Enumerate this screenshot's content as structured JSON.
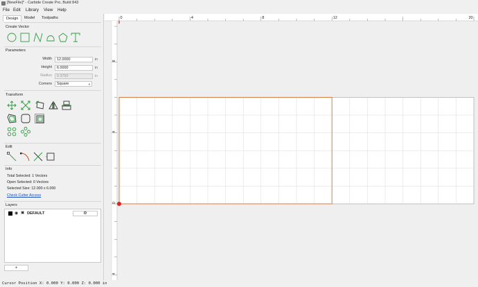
{
  "window": {
    "title": "[NewFile]* - Carbide Create Pro, Build 843"
  },
  "menu": [
    "File",
    "Edit",
    "Library",
    "View",
    "Help"
  ],
  "tabs": [
    {
      "label": "Design",
      "active": true
    },
    {
      "label": "Model",
      "active": false
    },
    {
      "label": "Toolpaths",
      "active": false
    }
  ],
  "create_vector": {
    "heading": "Create Vector",
    "tools": [
      "circle-icon",
      "rectangle-icon",
      "polyline-icon",
      "curve-icon",
      "polygon-icon",
      "text-icon"
    ]
  },
  "parameters": {
    "heading": "Parameters",
    "width": {
      "label": "Width",
      "value": "12.0000",
      "unit": "in"
    },
    "height": {
      "label": "Height",
      "value": "6.0000",
      "unit": "in"
    },
    "radius": {
      "label": "Radius",
      "value": "0.3750",
      "unit": "in"
    },
    "corners": {
      "label": "Corners",
      "value": "Square"
    }
  },
  "transform": {
    "heading": "Transform",
    "row1": [
      "move-icon",
      "scale-icon",
      "rotate-icon",
      "mirror-icon",
      "align-icon"
    ],
    "row2": [
      "offset-icon",
      "fillet-icon",
      "boolean-icon"
    ],
    "row3": [
      "circular-array-icon",
      "linear-array-icon"
    ]
  },
  "edit": {
    "heading": "Edit",
    "tools": [
      "node-edit-icon",
      "curve-edit-icon",
      "trim-icon",
      "join-icon"
    ]
  },
  "info": {
    "heading": "Info",
    "total_selected": "Total Selected:   1 Vectors",
    "open_selected": "Open Selected:   0 Vectors",
    "selected_size": "Selected Size:    12.000 x 6.000",
    "cutter_link": "Check Cutter Access"
  },
  "layers": {
    "heading": "Layers",
    "items": [
      {
        "name": "DEFAULT",
        "color": "#000000"
      }
    ],
    "add_label": "+"
  },
  "ruler": {
    "top_ticks": [
      "0",
      "4",
      "8",
      "12",
      "20"
    ],
    "left_ticks": [
      "8",
      "4",
      "0",
      "4"
    ]
  },
  "canvas": {
    "stock_width_in": 20,
    "stock_height_in": 6,
    "selection_width_in": 12,
    "selection_height_in": 6,
    "accent": "#e07a3c",
    "origin_color": "#e02020",
    "vector_color": "#2e9b3e"
  },
  "status": {
    "text": "Cursor Position X: 0.000 Y: 0.000 Z: 0.000 in"
  }
}
